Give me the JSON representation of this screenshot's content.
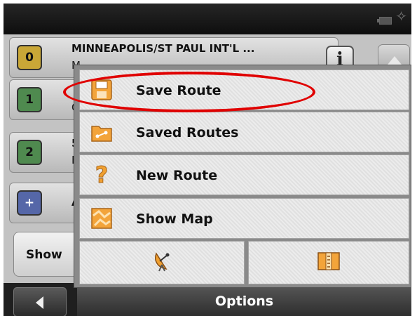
{
  "status_bar": {
    "icons": [
      "battery-icon",
      "gps-signal-icon"
    ]
  },
  "route_list": {
    "rows": [
      {
        "badge": "0",
        "badge_color": "#c9a737",
        "title": "MINNEAPOLIS/ST PAUL INT'L ...",
        "subtitle": "M"
      },
      {
        "badge": "1",
        "badge_color": "#4f8a4f",
        "title": "",
        "subtitle": "C"
      },
      {
        "badge": "2",
        "badge_color": "#4f8a4f",
        "title": "5",
        "subtitle": "B"
      },
      {
        "badge": "+",
        "badge_color": "#5567a8",
        "title": "A",
        "subtitle": ""
      }
    ],
    "info_label": "i",
    "show_label": "Show"
  },
  "options_menu": {
    "items": [
      {
        "label": "Save Route",
        "icon": "floppy-disk-icon"
      },
      {
        "label": "Saved Routes",
        "icon": "route-folder-icon"
      },
      {
        "label": "New Route",
        "icon": "question-mark-icon"
      },
      {
        "label": "Show Map",
        "icon": "map-icon"
      }
    ],
    "bottom_icons": [
      "gps-satellite-icon",
      "itinerary-book-icon"
    ],
    "title": "Options"
  },
  "annotation": {
    "color": "#e00000",
    "target": "Save Route"
  },
  "colors": {
    "accent_orange": "#f0a030",
    "header_dark": "#1a1a1a"
  }
}
